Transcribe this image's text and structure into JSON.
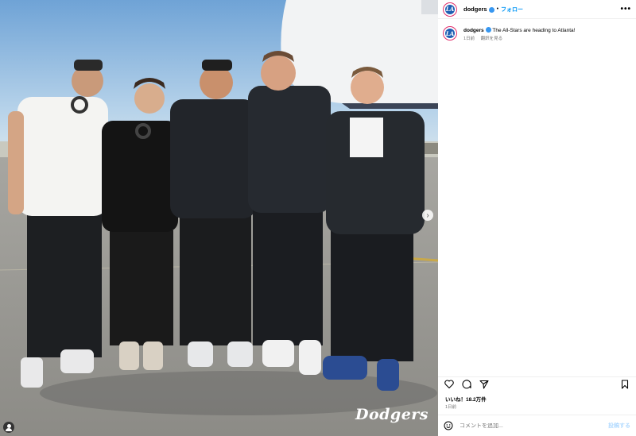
{
  "photo": {
    "watermark": "Dodgers",
    "next_icon": "chevron-right-icon",
    "user_tag_icon": "user-icon"
  },
  "header": {
    "username": "dodgers",
    "separator": "•",
    "follow_label": "フォロー",
    "more_label": "•••"
  },
  "caption": {
    "username": "dodgers",
    "text": "The All-Stars are heading to Atlanta!",
    "time": "1日前",
    "translate_label": "翻訳を見る"
  },
  "actions": {
    "icons": [
      "heart-icon",
      "comment-icon",
      "share-icon",
      "bookmark-icon"
    ]
  },
  "likes": "いいね！18.2万件",
  "date": "1日前",
  "comment": {
    "placeholder": "コメントを追加...",
    "post_label": "投稿する"
  },
  "colors": {
    "follow": "#0095f6",
    "verified": "#3897f0",
    "muted": "#737373",
    "post_disabled": "#b3dbff"
  }
}
